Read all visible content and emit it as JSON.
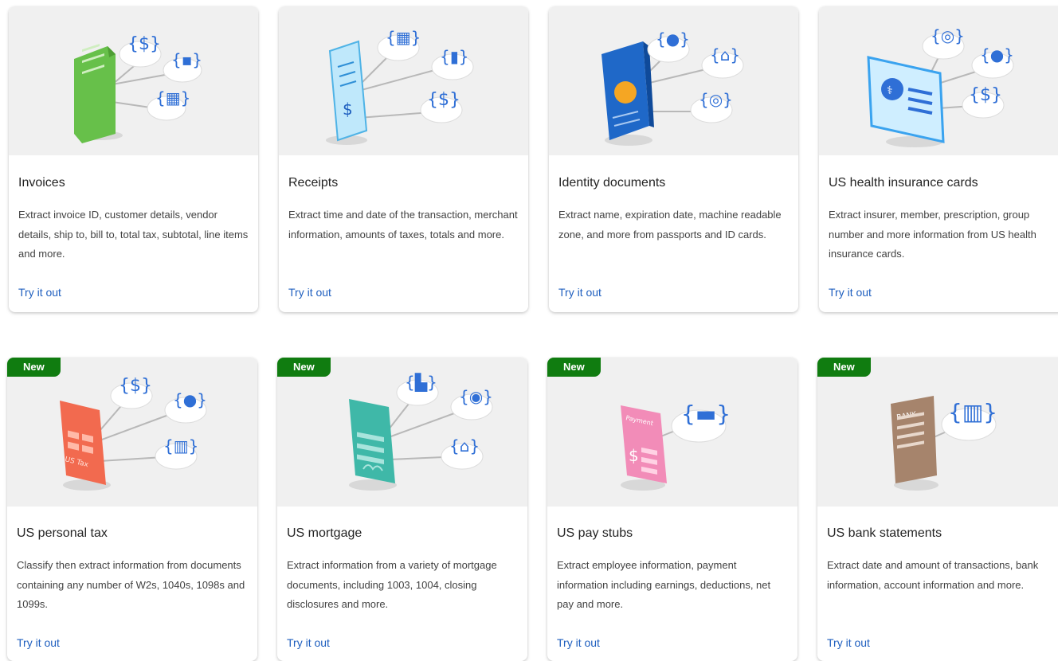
{
  "cards": [
    {
      "title": "Invoices",
      "description": "Extract invoice ID, customer details, vendor details, ship to, bill to, total tax, subtotal, line items and more.",
      "cta": "Try it out",
      "badge": "",
      "icon": "invoice-document-icon"
    },
    {
      "title": "Receipts",
      "description": "Extract time and date of the transaction, merchant information, amounts of taxes, totals and more.",
      "cta": "Try it out",
      "badge": "",
      "icon": "receipt-icon"
    },
    {
      "title": "Identity documents",
      "description": "Extract name, expiration date, machine readable zone, and more from passports and ID cards.",
      "cta": "Try it out",
      "badge": "",
      "icon": "passport-icon"
    },
    {
      "title": "US health insurance cards",
      "description": "Extract insurer, member, prescription, group number and more information from US health insurance cards.",
      "cta": "Try it out",
      "badge": "",
      "icon": "health-card-icon"
    },
    {
      "title": "US personal tax",
      "description": "Classify then extract information from documents containing any number of W2s, 1040s, 1098s and 1099s.",
      "cta": "Try it out",
      "badge": "New",
      "icon": "tax-form-icon"
    },
    {
      "title": "US mortgage",
      "description": "Extract information from a variety of mortgage documents, including 1003, 1004, closing disclosures and more.",
      "cta": "Try it out",
      "badge": "New",
      "icon": "mortgage-document-icon"
    },
    {
      "title": "US pay stubs",
      "description": "Extract employee information, payment information including earnings, deductions, net pay and more.",
      "cta": "Try it out",
      "badge": "New",
      "icon": "pay-stub-icon"
    },
    {
      "title": "US bank statements",
      "description": "Extract date and amount of transactions, bank information, account information and more.",
      "cta": "Try it out",
      "badge": "New",
      "icon": "bank-statement-icon"
    }
  ],
  "illustration_text": {
    "tax_label": "US Tax",
    "payment_label": "Payment",
    "bank_label": "BANK"
  },
  "colors": {
    "badge": "#107c10",
    "link": "#1f5fbf",
    "hero_bg": "#f0f0f0"
  }
}
